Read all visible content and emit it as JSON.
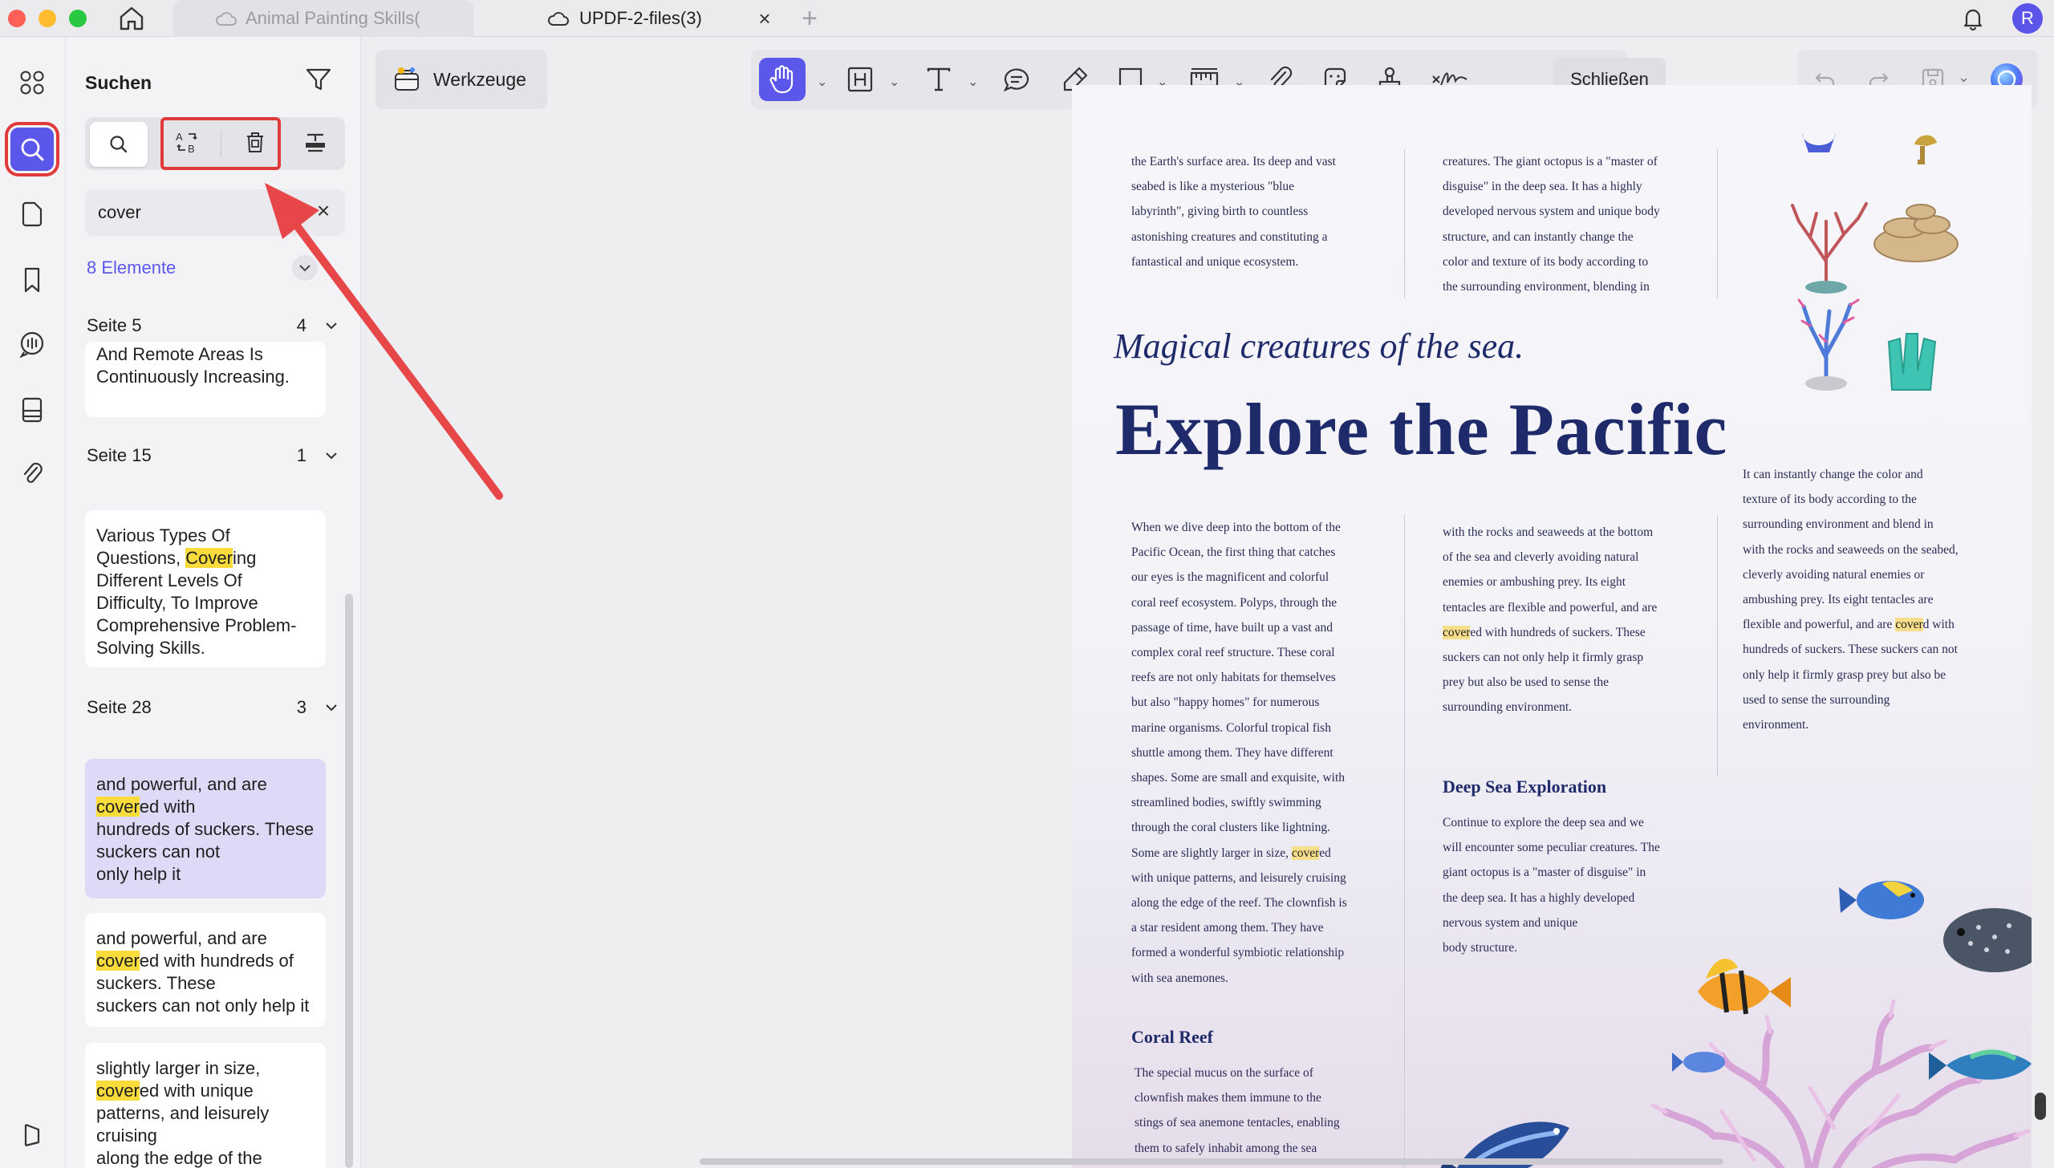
{
  "titlebar": {
    "tabs": [
      {
        "label": "Animal Painting Skills("
      },
      {
        "label": "UPDF-2-files(3)"
      }
    ],
    "close_tab": "×",
    "new_tab": "+",
    "avatar": "R"
  },
  "panel": {
    "title": "Suchen",
    "query": "cover",
    "clear": "×",
    "result_count": "8 Elemente",
    "groups": [
      {
        "page": "Seite 5",
        "count": "4"
      },
      {
        "page": "Seite 15",
        "count": "1"
      },
      {
        "page": "Seite 28",
        "count": "3"
      }
    ],
    "results": [
      {
        "before": "And Remote Areas Is\nContinuously Increasing.",
        "match": "",
        "after": ""
      },
      {
        "before": "Various Types Of\nQuestions, ",
        "match": "Cover",
        "after": "ing\nDifferent Levels Of\nDifficulty, To Improve\nComprehensive Problem-\nSolving Skills."
      },
      {
        "before": "and powerful, and are\n",
        "match": "cover",
        "after": "ed with\nhundreds of suckers. These\nsuckers can not\nonly help it"
      },
      {
        "before": "and powerful, and are\n",
        "match": "cover",
        "after": "ed with hundreds of\nsuckers. These\nsuckers can not only help it"
      },
      {
        "before": "slightly larger in size,\n",
        "match": "cover",
        "after": "ed with unique\npatterns, and leisurely\ncruising\nalong the edge of the"
      }
    ]
  },
  "workspace": {
    "tools_label": "Werkzeuge",
    "close_label": "Schließen"
  },
  "document": {
    "subtitle": "Magical creatures of the sea.",
    "title": "Explore the Pacific",
    "top_left": "the Earth's surface area. Its deep and vast\nseabed is like a mysterious \"blue\nlabyrinth\", giving birth to countless\nastonishing creatures and constituting a\nfantastical and unique ecosystem.",
    "top_mid": "creatures. The giant octopus is a \"master of\ndisguise\" in the deep sea. It has a highly\ndeveloped nervous system and unique body\nstructure, and can instantly change the\ncolor and texture of its body according to\nthe surrounding environment, blending in",
    "right_col_before": "It can instantly change the color and\ntexture of its body according to the\nsurrounding environment and blend in\nwith the rocks and seaweeds on the seabed,\ncleverly avoiding natural enemies or\nambushing prey. Its eight tentacles are\nflexible and powerful, and are ",
    "right_col_match": "cover",
    "right_col_after": "d with\nhundreds of suckers. These suckers can not\nonly help it firmly grasp prey but also be\nused to sense the surrounding\nenvironment.",
    "left_col_before": "When we dive deep into the bottom of the\nPacific Ocean, the first thing that catches\nour eyes is the magnificent and colorful\ncoral reef ecosystem. Polyps, through the\npassage of time, have built up a vast and\ncomplex coral reef structure. These coral\nreefs are not only habitats for themselves\nbut also \"happy homes\" for numerous\nmarine organisms. Colorful tropical fish\nshuttle among them. They have different\nshapes. Some are small and exquisite, with\nstreamlined bodies, swiftly swimming\nthrough the coral clusters like lightning.\nSome are slightly larger in size, ",
    "left_col_match": "cover",
    "left_col_after": "ed\nwith unique patterns, and leisurely cruising\nalong the edge of the reef. The clownfish is\na star resident among them. They have\nformed a wonderful symbiotic relationship\nwith sea anemones.",
    "mid_col_before": "with the rocks and seaweeds at the bottom\nof the sea and cleverly avoiding natural\nenemies or ambushing prey. Its eight\ntentacles are flexible and powerful, and are\n",
    "mid_col_match": "cover",
    "mid_col_after": "ed with hundreds of suckers. These\nsuckers can not only help it firmly grasp\nprey but also be used to sense the\nsurrounding environment.",
    "heading_deep": "Deep Sea Exploration",
    "deep_text": "Continue to explore the deep sea and we\nwill encounter some peculiar creatures. The\ngiant octopus is a \"master of disguise\" in\nthe deep sea. It has a highly developed\nnervous system and unique\nbody structure.",
    "heading_coral": "Coral Reef",
    "coral_text": "The special mucus on the surface of\nclownfish makes them immune to the\nstings of sea anemone tentacles, enabling\nthem to safely inhabit among the sea\nanemones. At the same time, the"
  }
}
